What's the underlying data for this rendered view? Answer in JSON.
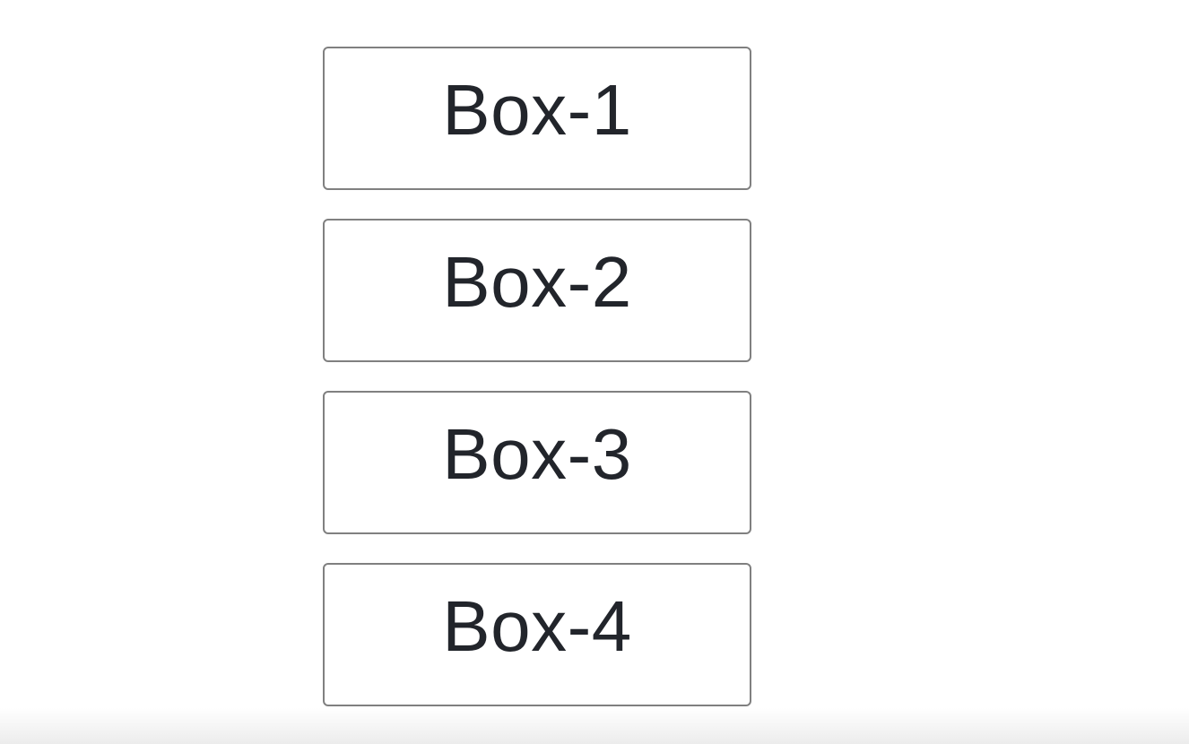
{
  "boxes": [
    {
      "label": "Box-1"
    },
    {
      "label": "Box-2"
    },
    {
      "label": "Box-3"
    },
    {
      "label": "Box-4"
    }
  ],
  "colors": {
    "text": "#22252b",
    "border": "#808080",
    "background": "#ffffff"
  }
}
